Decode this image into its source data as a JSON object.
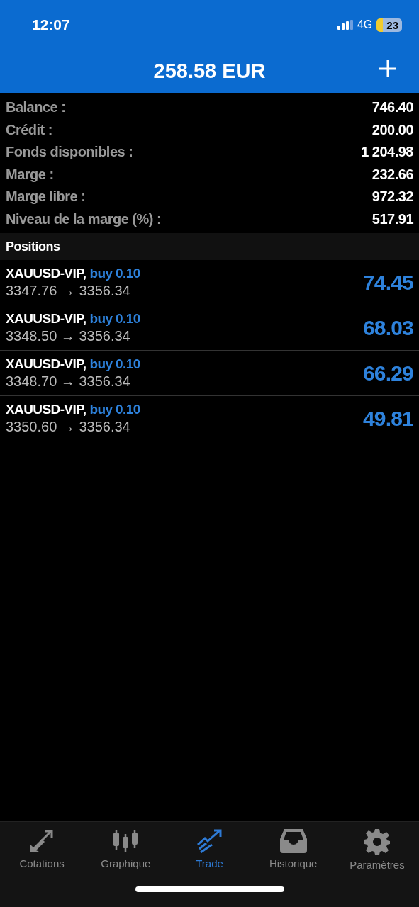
{
  "status_bar": {
    "time": "12:07",
    "network": "4G",
    "battery": "23"
  },
  "header": {
    "title": "258.58 EUR"
  },
  "summary": [
    {
      "label": "Balance :",
      "value": "746.40"
    },
    {
      "label": "Crédit :",
      "value": "200.00"
    },
    {
      "label": "Fonds disponibles :",
      "value": "1 204.98"
    },
    {
      "label": "Marge :",
      "value": "232.66"
    },
    {
      "label": "Marge libre :",
      "value": "972.32"
    },
    {
      "label": "Niveau de la marge (%) :",
      "value": "517.91"
    }
  ],
  "positions": {
    "title": "Positions",
    "items": [
      {
        "symbol": "XAUUSD-VIP,",
        "order": "buy 0.10",
        "prices": "3347.76 → 3356.34",
        "profit": "74.45"
      },
      {
        "symbol": "XAUUSD-VIP,",
        "order": "buy 0.10",
        "prices": "3348.50 → 3356.34",
        "profit": "68.03"
      },
      {
        "symbol": "XAUUSD-VIP,",
        "order": "buy 0.10",
        "prices": "3348.70 → 3356.34",
        "profit": "66.29"
      },
      {
        "symbol": "XAUUSD-VIP,",
        "order": "buy 0.10",
        "prices": "3350.60 → 3356.34",
        "profit": "49.81"
      }
    ]
  },
  "tabs": [
    {
      "kind": "quotes",
      "label": "Cotations",
      "selected": false
    },
    {
      "kind": "chart",
      "label": "Graphique",
      "selected": false
    },
    {
      "kind": "trade",
      "label": "Trade",
      "selected": true
    },
    {
      "kind": "history",
      "label": "Historique",
      "selected": false
    },
    {
      "kind": "settings",
      "label": "Paramètres",
      "selected": false
    }
  ]
}
